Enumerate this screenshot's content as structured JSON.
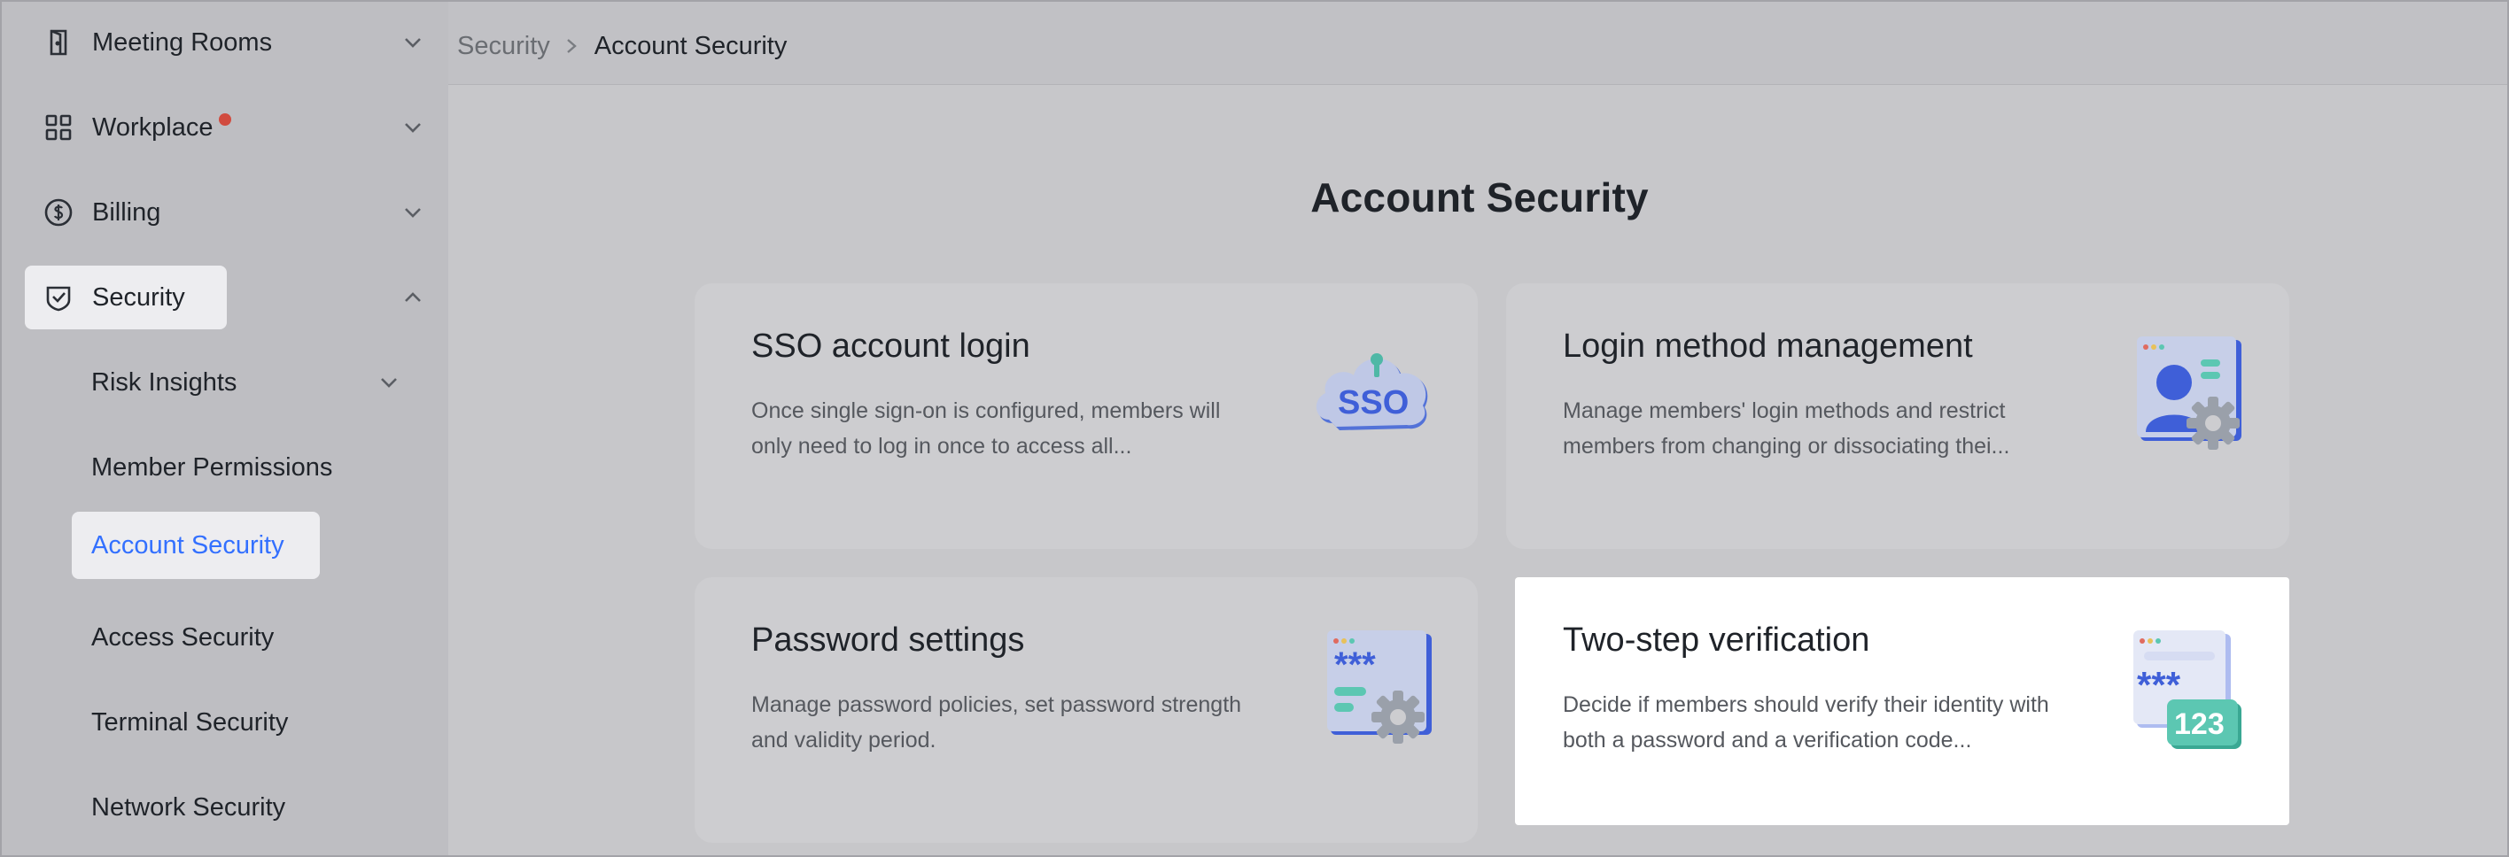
{
  "sidebar": {
    "items": [
      {
        "label": "Meeting Rooms",
        "icon": "door-icon",
        "chevron": "down"
      },
      {
        "label": "Workplace",
        "icon": "grid-icon",
        "chevron": "down",
        "badge": true
      },
      {
        "label": "Billing",
        "icon": "dollar-circle-icon",
        "chevron": "down"
      },
      {
        "label": "Security",
        "icon": "shield-check-icon",
        "chevron": "up",
        "expanded": true
      }
    ],
    "security_children": [
      {
        "label": "Risk Insights",
        "chevron": "down"
      },
      {
        "label": "Member Permissions"
      },
      {
        "label": "Account Security",
        "selected": true
      },
      {
        "label": "Access Security"
      },
      {
        "label": "Terminal Security"
      },
      {
        "label": "Network Security"
      }
    ]
  },
  "breadcrumb": {
    "parent": "Security",
    "current": "Account Security"
  },
  "main": {
    "title": "Account Security",
    "cards": [
      {
        "title": "SSO account login",
        "desc": "Once single sign-on is configured, members will only need to log in once to access all...",
        "icon": "sso-cloud-icon"
      },
      {
        "title": "Login method management",
        "desc": "Manage members' login methods and restrict members from changing or dissociating thei...",
        "icon": "user-gear-icon"
      },
      {
        "title": "Password settings",
        "desc": "Manage password policies, set password strength and validity period.",
        "icon": "password-gear-icon"
      },
      {
        "title": "Two-step verification",
        "desc": "Decide if members should verify their identity with both a password and a verification code...",
        "icon": "two-step-123-icon",
        "badge_text": "123"
      }
    ]
  },
  "colors": {
    "accent": "#3370ff",
    "badge": "#d14b3f",
    "illustration_blue": "#3f5fd8",
    "illustration_teal": "#5cc7b2"
  }
}
